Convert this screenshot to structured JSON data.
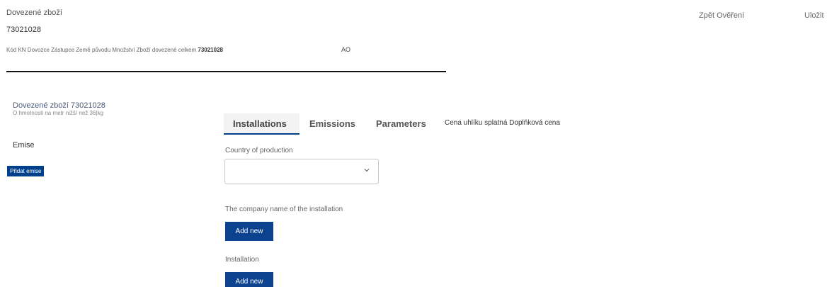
{
  "header": {
    "title": "Dovezené zboží",
    "code": "73021028",
    "back_label": "Zpět",
    "verify_label": "Ověření",
    "save_label": "Uložit"
  },
  "meta": {
    "labels": "Kód KN Dovozce Zástupce Země původu Množství Zboží dovezené celkem",
    "total_code": "73021028",
    "origin_value": "AO"
  },
  "goods": {
    "title": "Dovezené zboží 73021028",
    "subtitle": "O hmotnosti na metr nižší než 36|kg"
  },
  "emissions": {
    "label": "Emise",
    "add_button": "Přidat emise"
  },
  "tabs": [
    {
      "label": "Installations",
      "active": true
    },
    {
      "label": "Emissions",
      "active": false
    },
    {
      "label": "Parameters",
      "active": false
    }
  ],
  "price_label": "Cena uhlíku splatná Doplňková cena",
  "form": {
    "country_label": "Country of production",
    "country_value": "",
    "company_label": "The company name of the installation",
    "company_add_button": "Add new",
    "installation_label": "Installation",
    "installation_add_button": "Add new"
  },
  "colors": {
    "primary_button": "#0c4391",
    "small_button": "#003f8a",
    "divider": "#111111"
  },
  "icons": {
    "country_select": "chevron-down-icon"
  }
}
